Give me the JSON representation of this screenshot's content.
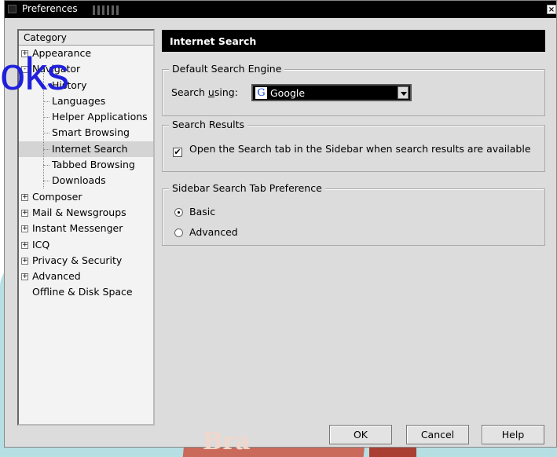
{
  "window": {
    "title": "Preferences",
    "close_glyph": "×"
  },
  "watermark": {
    "logo_text": "oks",
    "book_text": "Bra"
  },
  "category": {
    "header": "Category",
    "items": [
      {
        "label": "Appearance",
        "expander": "+",
        "level": 0
      },
      {
        "label": "Navigator",
        "expander": "-",
        "level": 0
      },
      {
        "label": "History",
        "level": 1
      },
      {
        "label": "Languages",
        "level": 1
      },
      {
        "label": "Helper Applications",
        "level": 1
      },
      {
        "label": "Smart Browsing",
        "level": 1
      },
      {
        "label": "Internet Search",
        "level": 1,
        "selected": true
      },
      {
        "label": "Tabbed Browsing",
        "level": 1
      },
      {
        "label": "Downloads",
        "level": 1
      },
      {
        "label": "Composer",
        "expander": "+",
        "level": 0
      },
      {
        "label": "Mail & Newsgroups",
        "expander": "+",
        "level": 0
      },
      {
        "label": "Instant Messenger",
        "expander": "+",
        "level": 0
      },
      {
        "label": "ICQ",
        "expander": "+",
        "level": 0
      },
      {
        "label": "Privacy & Security",
        "expander": "+",
        "level": 0
      },
      {
        "label": "Advanced",
        "expander": "+",
        "level": 0
      },
      {
        "label": "Offline & Disk Space",
        "level": 0
      }
    ]
  },
  "panel": {
    "title": "Internet Search",
    "default_engine": {
      "group_label": "Default Search Engine",
      "search_label_pre": "Search ",
      "search_label_access": "u",
      "search_label_post": "sing:",
      "engine_icon": "G",
      "engine_value": "Google"
    },
    "results": {
      "group_label": "Search Results",
      "checkbox_label": "Open the Search tab in the Sidebar when search results are available",
      "checked": true,
      "check_glyph": "✔"
    },
    "sidebar_pref": {
      "group_label": "Sidebar Search Tab Preference",
      "options": [
        {
          "label": "Basic",
          "selected": true
        },
        {
          "label": "Advanced",
          "selected": false
        }
      ]
    }
  },
  "buttons": {
    "ok": "OK",
    "cancel": "Cancel",
    "help": "Help"
  },
  "icons": [
    "window-icon",
    "close-icon",
    "expander-icon",
    "google-icon",
    "dropdown-arrow-icon",
    "checkbox-icon",
    "radio-icon"
  ]
}
